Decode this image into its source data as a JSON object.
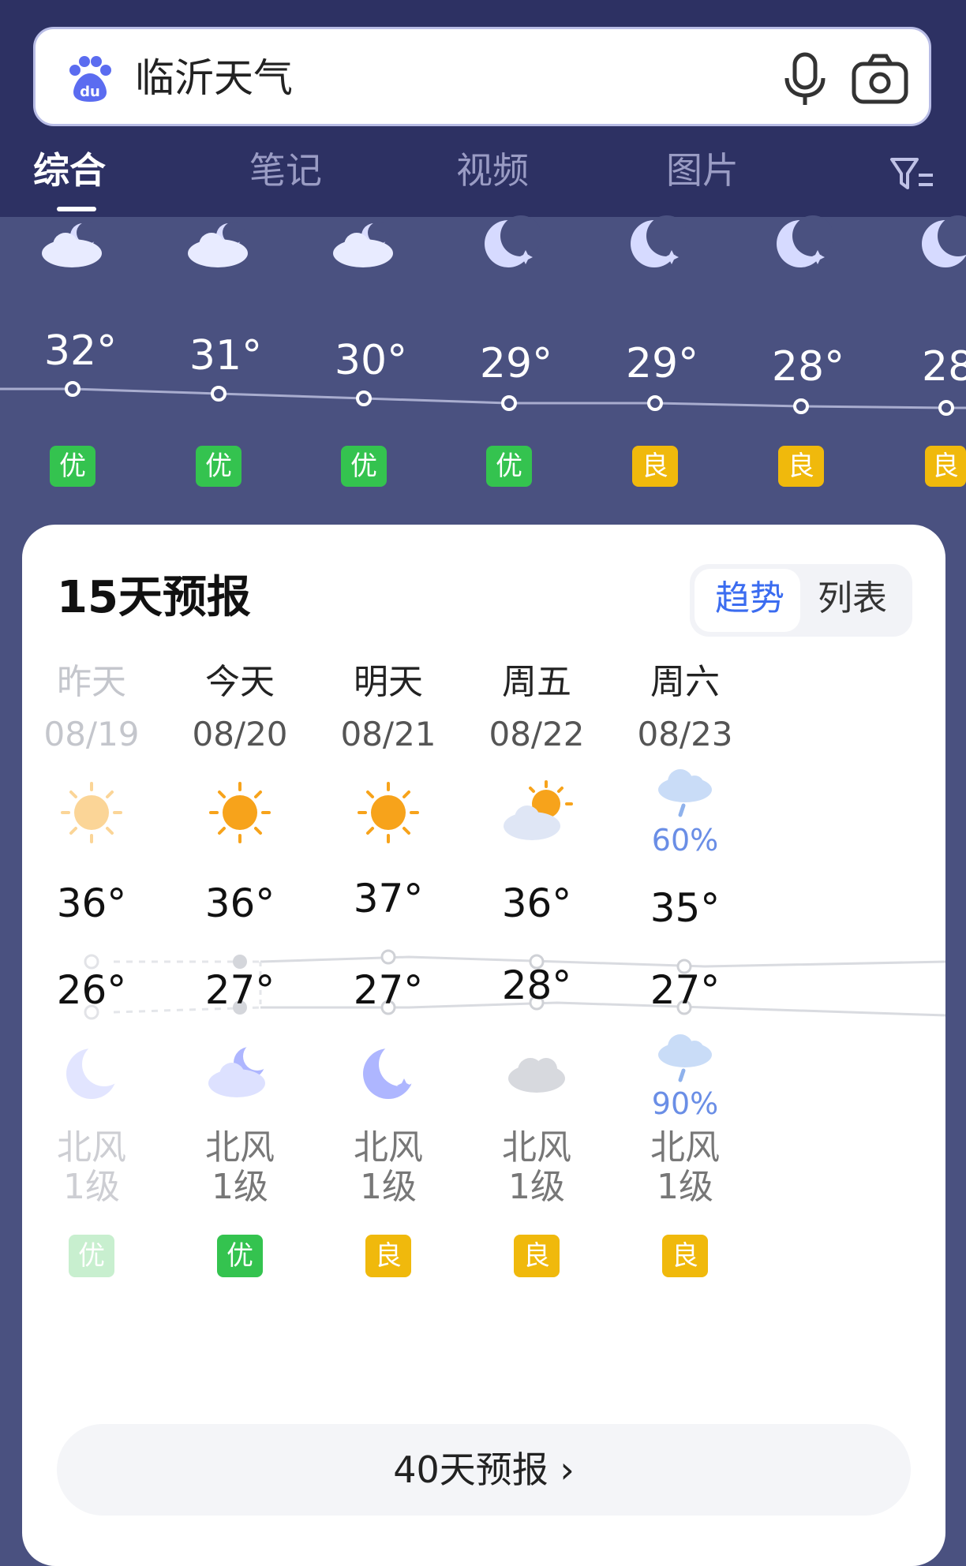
{
  "search": {
    "query": "临沂天气"
  },
  "tabs": [
    {
      "label": "综合",
      "active": true
    },
    {
      "label": "笔记"
    },
    {
      "label": "视频"
    },
    {
      "label": "图片"
    }
  ],
  "hourly": [
    {
      "icon": "cloudy-night-icon",
      "temp": "32°",
      "aqi": "优",
      "aqi_level": "good"
    },
    {
      "icon": "cloudy-night-icon",
      "temp": "31°",
      "aqi": "优",
      "aqi_level": "good"
    },
    {
      "icon": "cloudy-night-icon",
      "temp": "30°",
      "aqi": "优",
      "aqi_level": "good"
    },
    {
      "icon": "moon-icon",
      "temp": "29°",
      "aqi": "优",
      "aqi_level": "good"
    },
    {
      "icon": "moon-icon",
      "temp": "29°",
      "aqi": "良",
      "aqi_level": "moderate"
    },
    {
      "icon": "moon-icon",
      "temp": "28°",
      "aqi": "良",
      "aqi_level": "moderate"
    },
    {
      "icon": "moon-icon",
      "temp": "28",
      "aqi": "良",
      "aqi_level": "moderate"
    }
  ],
  "forecast": {
    "title": "15天预报",
    "toggle": {
      "trend": "趋势",
      "list": "列表",
      "selected": "趋势"
    },
    "days": [
      {
        "name": "昨天",
        "date": "08/19",
        "day_icon": "sun-icon",
        "precip_day": "",
        "high": "36°",
        "low": "26°",
        "night_icon": "moon-icon",
        "precip_night": "",
        "wind": "北风",
        "wind_level": "1级",
        "aqi": "优",
        "aqi_level": "good",
        "past": true
      },
      {
        "name": "今天",
        "date": "08/20",
        "day_icon": "sun-icon",
        "precip_day": "",
        "high": "36°",
        "low": "27°",
        "night_icon": "cloudy-night-icon",
        "precip_night": "",
        "wind": "北风",
        "wind_level": "1级",
        "aqi": "优",
        "aqi_level": "good"
      },
      {
        "name": "明天",
        "date": "08/21",
        "day_icon": "sun-icon",
        "precip_day": "",
        "high": "37°",
        "low": "27°",
        "night_icon": "moon-icon",
        "precip_night": "",
        "wind": "北风",
        "wind_level": "1级",
        "aqi": "良",
        "aqi_level": "moderate"
      },
      {
        "name": "周五",
        "date": "08/22",
        "day_icon": "partly-cloudy-icon",
        "precip_day": "",
        "high": "36°",
        "low": "28°",
        "night_icon": "cloud-icon",
        "precip_night": "",
        "wind": "北风",
        "wind_level": "1级",
        "aqi": "良",
        "aqi_level": "moderate"
      },
      {
        "name": "周六",
        "date": "08/23",
        "day_icon": "rain-icon",
        "precip_day": "60%",
        "high": "35°",
        "low": "27°",
        "night_icon": "rain-icon",
        "precip_night": "90%",
        "wind": "北风",
        "wind_level": "1级",
        "aqi": "良",
        "aqi_level": "moderate"
      }
    ],
    "more_button": "40天预报 ›"
  },
  "colors": {
    "header": "#2d3163",
    "background": "#4a5180",
    "aqi_good": "#34c34f",
    "aqi_moderate": "#f0b90c",
    "accent": "#3b6cf0"
  }
}
